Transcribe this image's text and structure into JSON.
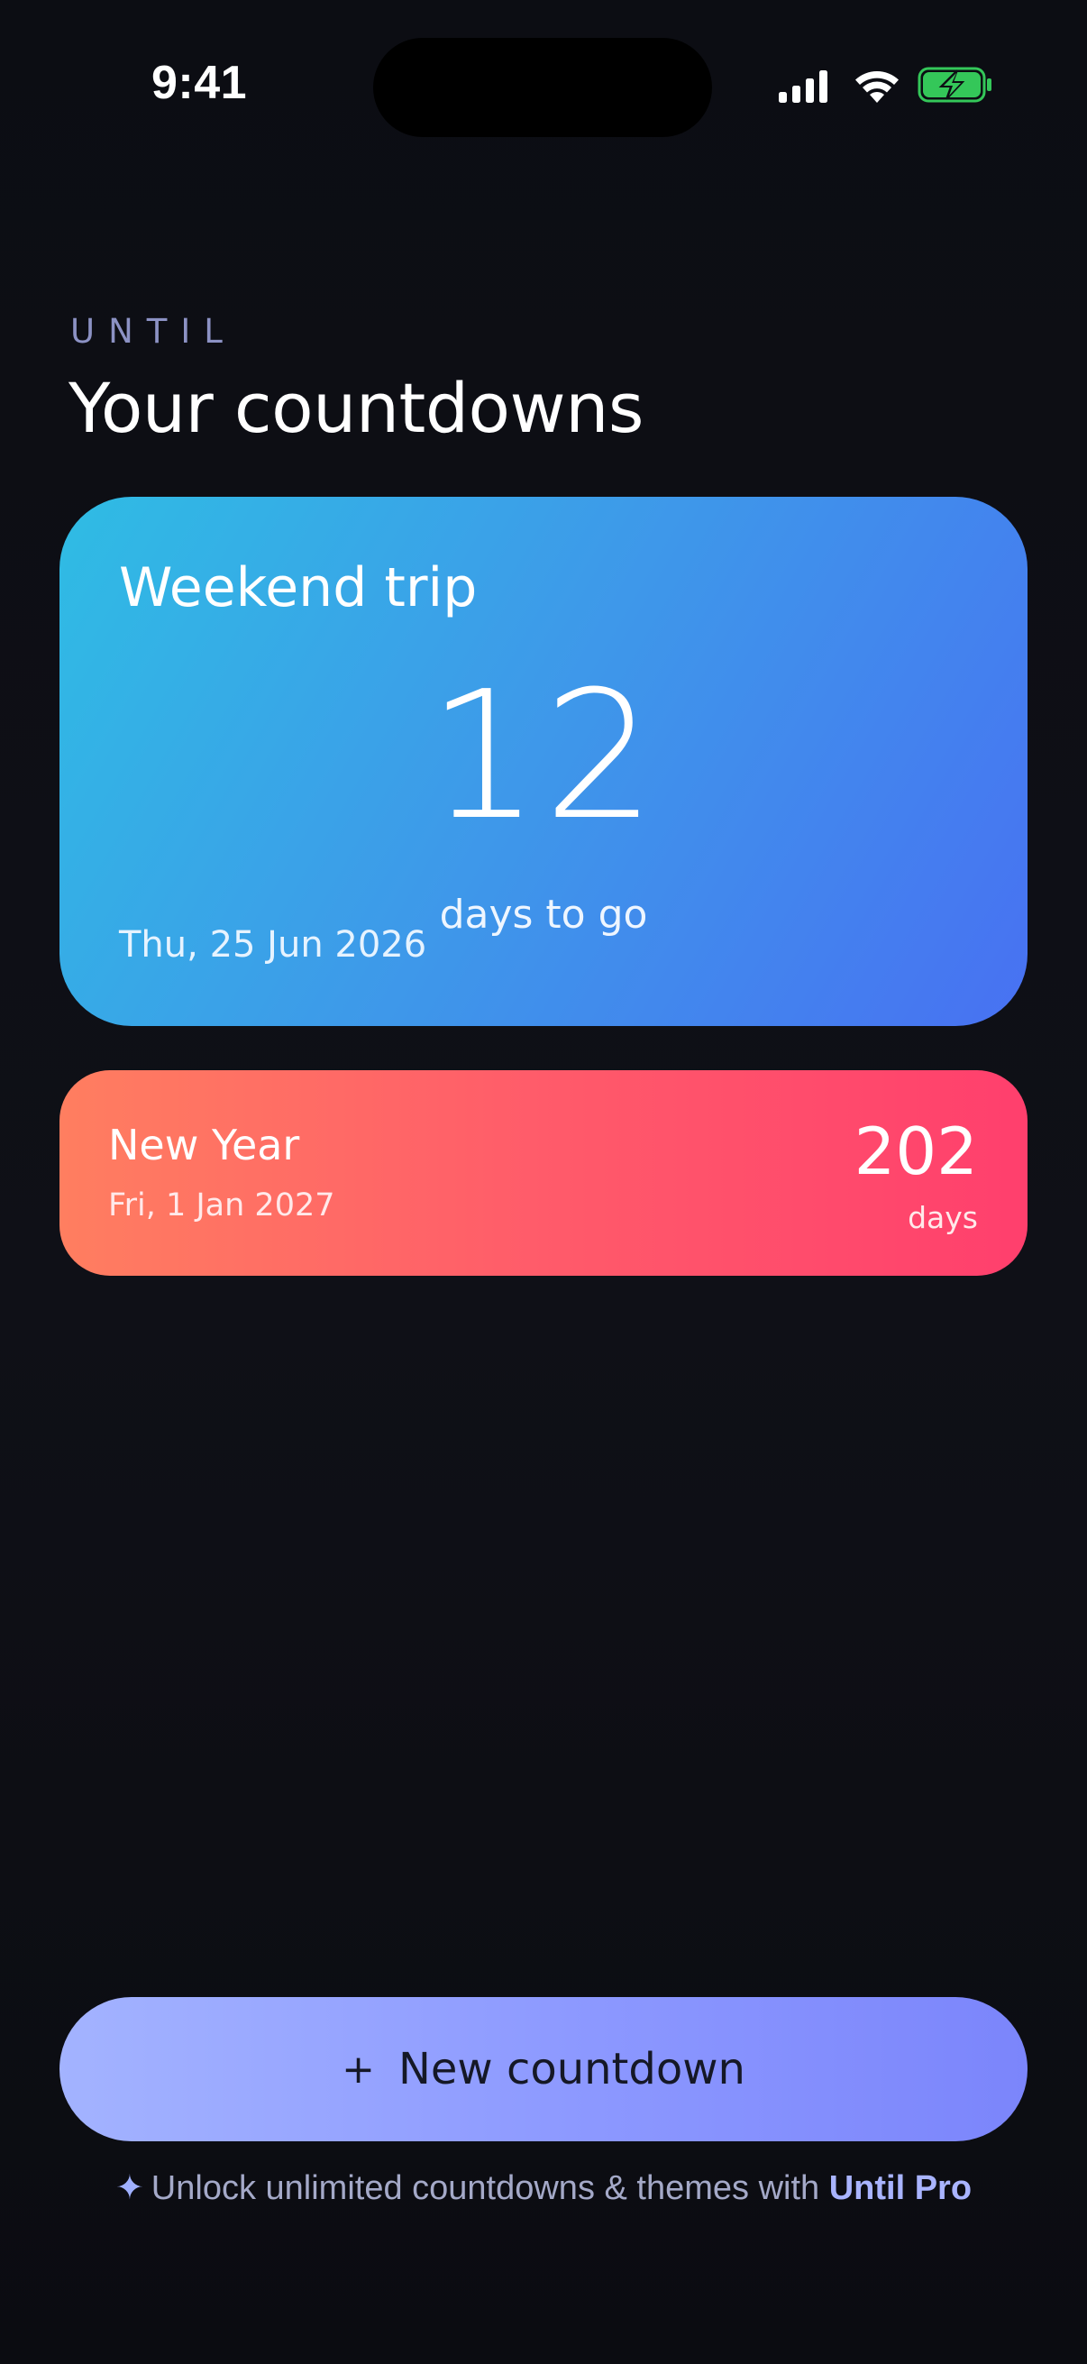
{
  "status_bar": {
    "time": "9:41",
    "icons": [
      "cellular-signal-icon",
      "wifi-icon",
      "battery-charging-icon"
    ],
    "battery_color": "#34c759"
  },
  "header": {
    "eyebrow": "UNTIL",
    "title": "Your countdowns"
  },
  "featured": {
    "title": "Weekend trip",
    "count": "12",
    "unit": "days to go",
    "date": "Thu, 25 Jun 2026",
    "gradient": [
      "#2fbce4",
      "#4871f2"
    ]
  },
  "countdowns": [
    {
      "title": "New Year",
      "date": "Fri, 1 Jan 2027",
      "count": "202",
      "unit": "days",
      "gradient": [
        "#ff7e60",
        "#ff3f6d"
      ]
    }
  ],
  "cta": {
    "icon": "plus-icon",
    "plus": "+",
    "label": "New countdown"
  },
  "promo": {
    "icon": "sparkle-icon",
    "spark": "✦",
    "text": "Unlock unlimited countdowns & themes with",
    "link": "Until Pro"
  },
  "colors": {
    "background": "#0d0e14",
    "accent": "#8c98ff"
  }
}
